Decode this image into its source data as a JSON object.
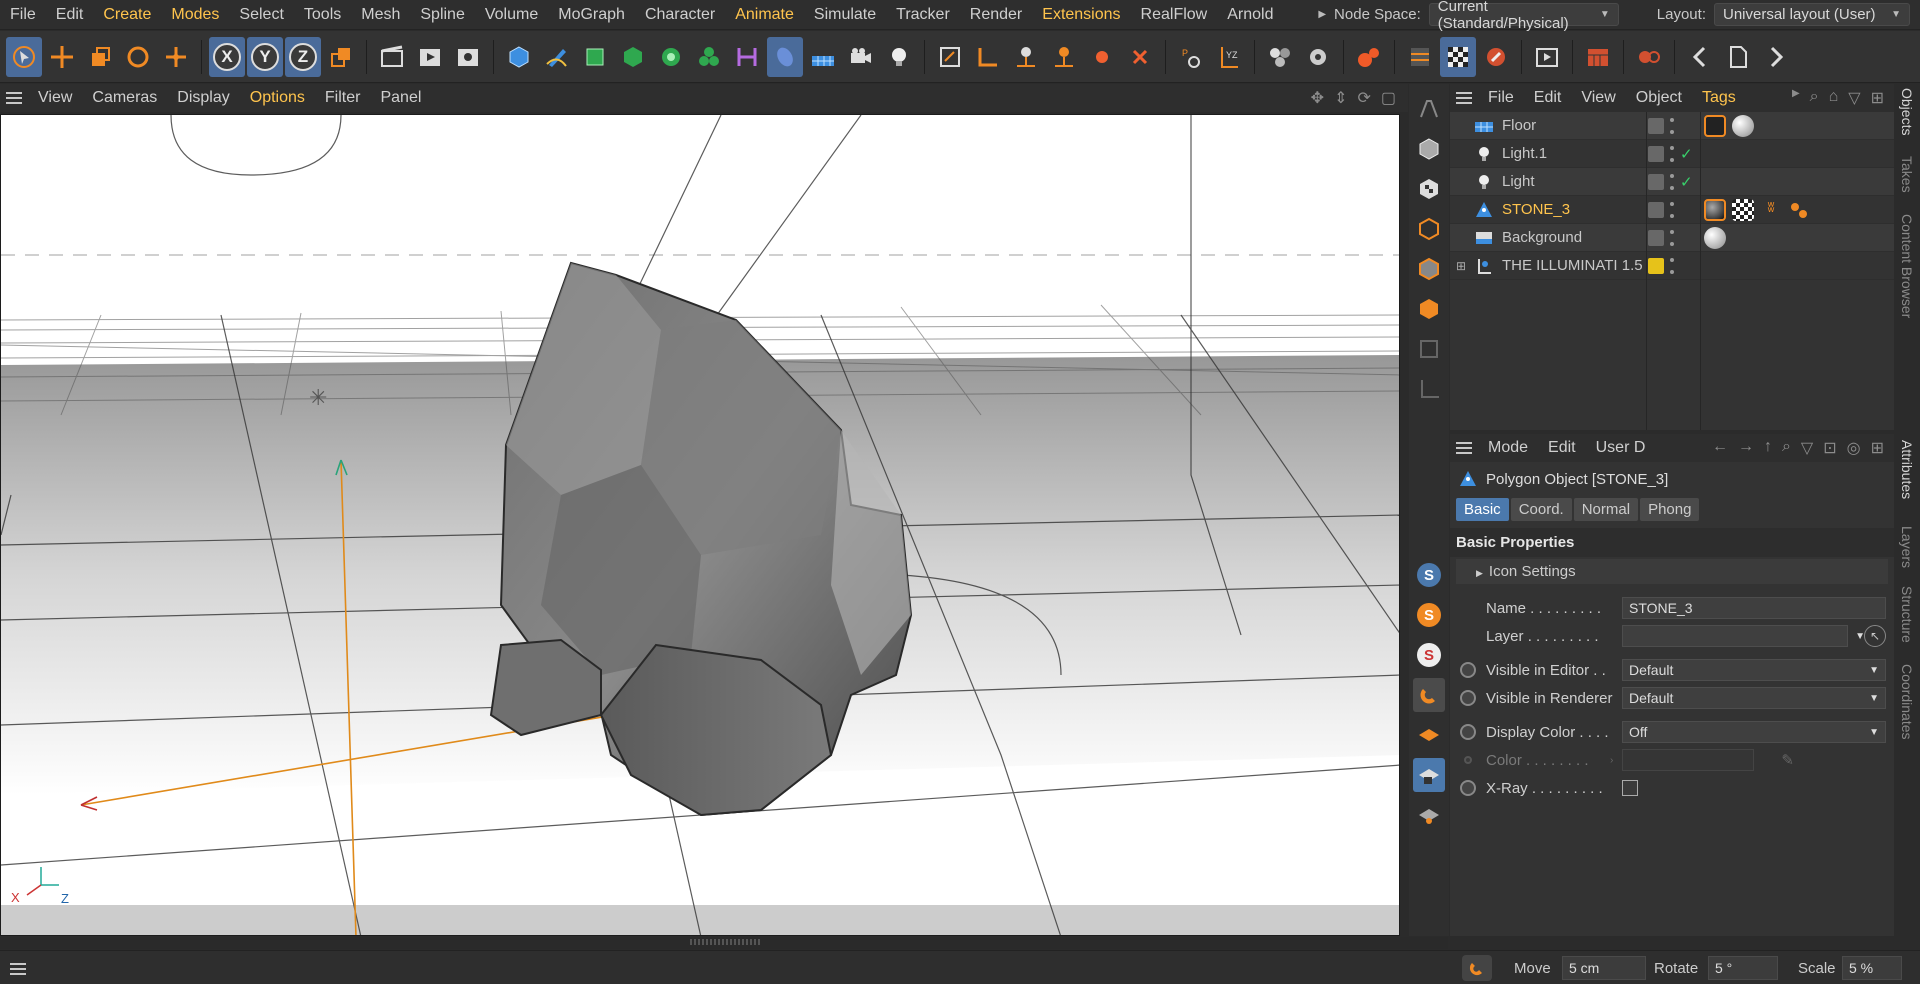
{
  "menu": {
    "items": [
      {
        "label": "File",
        "hl": false
      },
      {
        "label": "Edit",
        "hl": false
      },
      {
        "label": "Create",
        "hl": true
      },
      {
        "label": "Modes",
        "hl": true
      },
      {
        "label": "Select",
        "hl": false
      },
      {
        "label": "Tools",
        "hl": false
      },
      {
        "label": "Mesh",
        "hl": false
      },
      {
        "label": "Spline",
        "hl": false
      },
      {
        "label": "Volume",
        "hl": false
      },
      {
        "label": "MoGraph",
        "hl": false
      },
      {
        "label": "Character",
        "hl": false
      },
      {
        "label": "Animate",
        "hl": true
      },
      {
        "label": "Simulate",
        "hl": false
      },
      {
        "label": "Tracker",
        "hl": false
      },
      {
        "label": "Render",
        "hl": false
      },
      {
        "label": "Extensions",
        "hl": true
      },
      {
        "label": "RealFlow",
        "hl": false
      },
      {
        "label": "Arnold",
        "hl": false
      }
    ],
    "node_space_label": "Node Space:",
    "node_space_value": "Current (Standard/Physical)",
    "layout_label": "Layout:",
    "layout_value": "Universal layout (User)"
  },
  "toolbar": {
    "axis_x": "X",
    "axis_y": "Y",
    "axis_z": "Z",
    "accent": "#4a6b9a"
  },
  "viewport": {
    "menu": [
      "View",
      "Cameras",
      "Display",
      "Options",
      "Filter",
      "Panel"
    ],
    "options_highlight": "Options",
    "axis_x": "X",
    "axis_z": "Z"
  },
  "objects": {
    "menu": [
      "File",
      "Edit",
      "View",
      "Object",
      "Tags"
    ],
    "tags_highlight": "Tags",
    "rows": [
      {
        "name": "Floor",
        "icon": "floor-icon",
        "selected": false,
        "check": false
      },
      {
        "name": "Light.1",
        "icon": "light-icon",
        "selected": false,
        "check": true
      },
      {
        "name": "Light",
        "icon": "light-icon",
        "selected": false,
        "check": true
      },
      {
        "name": "STONE_3",
        "icon": "polygon-icon",
        "selected": true,
        "check": false
      },
      {
        "name": "Background",
        "icon": "background-icon",
        "selected": false,
        "check": false
      },
      {
        "name": "THE ILLUMINATI 1.5",
        "icon": "null-icon",
        "selected": false,
        "check": false
      }
    ]
  },
  "side_tabs": [
    "Objects",
    "Takes",
    "Content Browser",
    "Attributes",
    "Layers",
    "Structure",
    "Coordinates"
  ],
  "attributes": {
    "menu": [
      "Mode",
      "Edit",
      "User D"
    ],
    "object_title": "Polygon Object [STONE_3]",
    "tabs": [
      "Basic",
      "Coord.",
      "Normal",
      "Phong"
    ],
    "active_tab": "Basic",
    "section_title": "Basic Properties",
    "subsection": "Icon Settings",
    "props": {
      "name_label": "Name . . . . . . . . .",
      "name_value": "STONE_3",
      "layer_label": "Layer . . . . . . . . .",
      "vis_editor_label": "Visible in Editor . .",
      "vis_editor_value": "Default",
      "vis_render_label": "Visible in Renderer",
      "vis_render_value": "Default",
      "display_color_label": "Display Color . . . .",
      "display_color_value": "Off",
      "color_label": "Color . . . . . . . .",
      "xray_label": "X-Ray . . . . . . . . .",
      "xray_checked": false
    }
  },
  "status": {
    "move_label": "Move",
    "move_value": "5 cm",
    "rotate_label": "Rotate",
    "rotate_value": "5 °",
    "scale_label": "Scale",
    "scale_value": "5 %"
  },
  "colors": {
    "highlight_text": "#ffc44d",
    "selected_tab": "#4b79ad",
    "check_green": "#38d16b"
  }
}
